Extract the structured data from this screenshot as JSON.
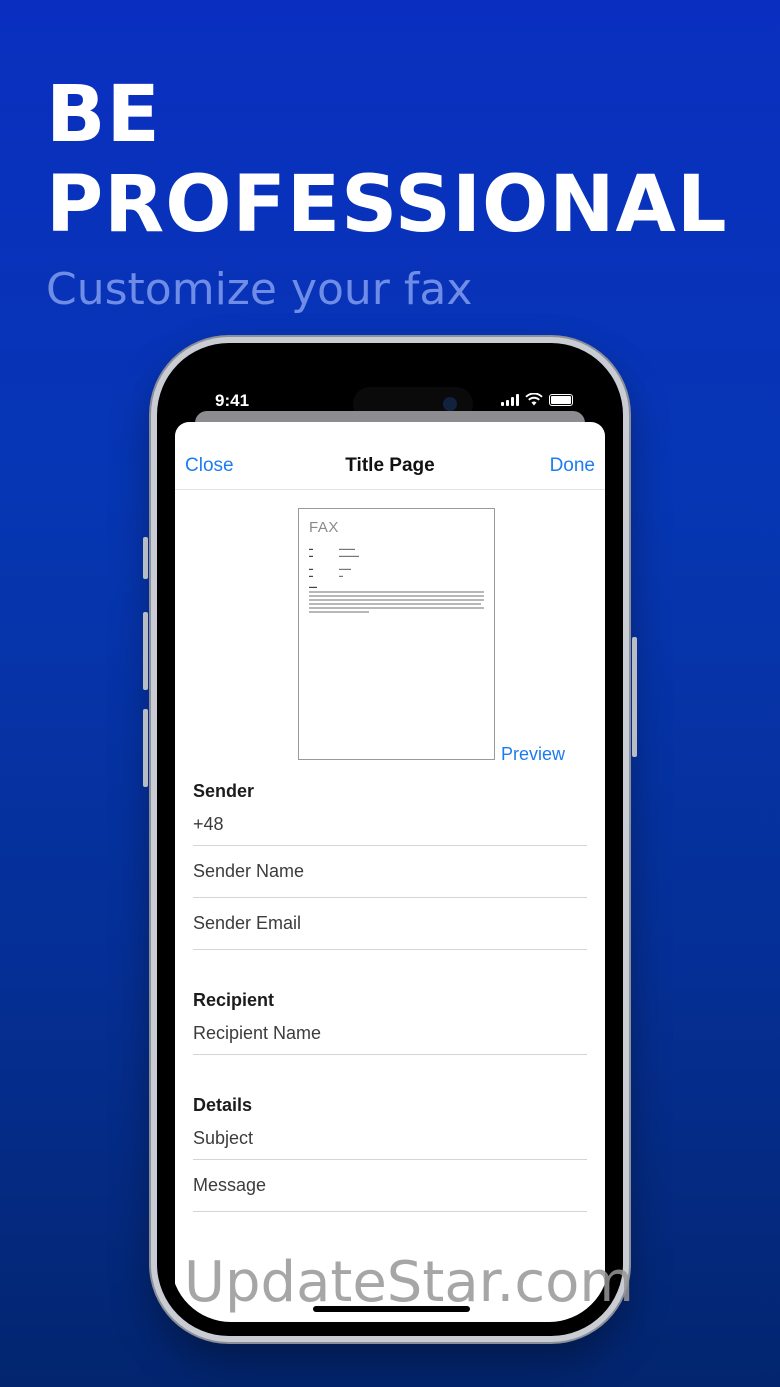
{
  "promo": {
    "headline_line1": "BE",
    "headline_line2": "PROFESSIONAL",
    "subheadline": "Customize your fax"
  },
  "status_bar": {
    "time": "9:41"
  },
  "nav": {
    "close_label": "Close",
    "title": "Title Page",
    "done_label": "Done"
  },
  "fax_preview": {
    "header": "FAX",
    "preview_label": "Preview"
  },
  "sender": {
    "section_title": "Sender",
    "phone_value": "+48",
    "name_placeholder": "Sender Name",
    "email_placeholder": "Sender Email"
  },
  "recipient": {
    "section_title": "Recipient",
    "name_placeholder": "Recipient Name"
  },
  "details": {
    "section_title": "Details",
    "subject_placeholder": "Subject",
    "message_placeholder": "Message"
  },
  "watermark": "UpdateStar.com",
  "colors": {
    "accent": "#1d7cf2",
    "background_top": "#0a2fc0",
    "background_bottom": "#03256f"
  }
}
